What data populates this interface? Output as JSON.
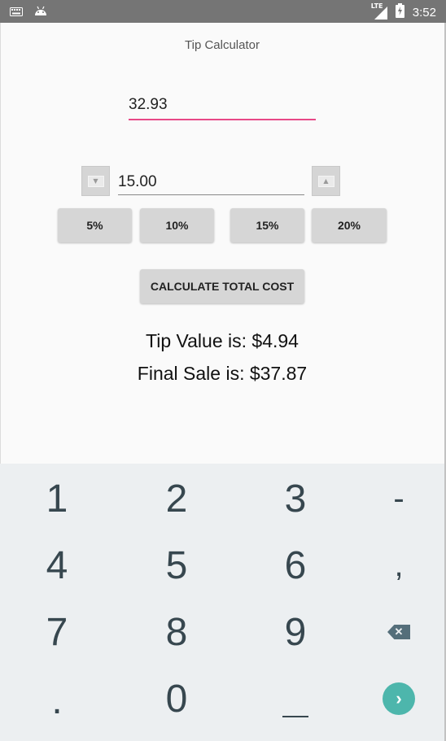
{
  "status_bar": {
    "time": "3:52",
    "network": "LTE",
    "left_icons": [
      "keyboard-icon",
      "android-icon"
    ],
    "right_icons": [
      "signal-icon",
      "battery-icon"
    ]
  },
  "app": {
    "title": "Tip Calculator"
  },
  "form": {
    "bill_amount": "32.93",
    "tip_percent": "15.00",
    "decrement_icon": "chevron-down-icon",
    "increment_icon": "chevron-up-icon"
  },
  "percent_buttons": [
    "5%",
    "10%",
    "15%",
    "20%"
  ],
  "calculate_label": "CALCULATE TOTAL COST",
  "results": {
    "tip_line": "Tip Value is: $4.94",
    "final_line": "Final Sale is: $37.87"
  },
  "keyboard": {
    "keys": [
      "1",
      "2",
      "3",
      "-",
      "4",
      "5",
      "6",
      ",",
      "7",
      "8",
      "9",
      "backspace",
      ".",
      "0",
      "space",
      "enter"
    ]
  },
  "colors": {
    "accent": "#e84887",
    "keyboard_bg": "#eceff1",
    "key_text": "#37474f",
    "enter_key": "#4db6ac",
    "status_bar": "#757575"
  }
}
